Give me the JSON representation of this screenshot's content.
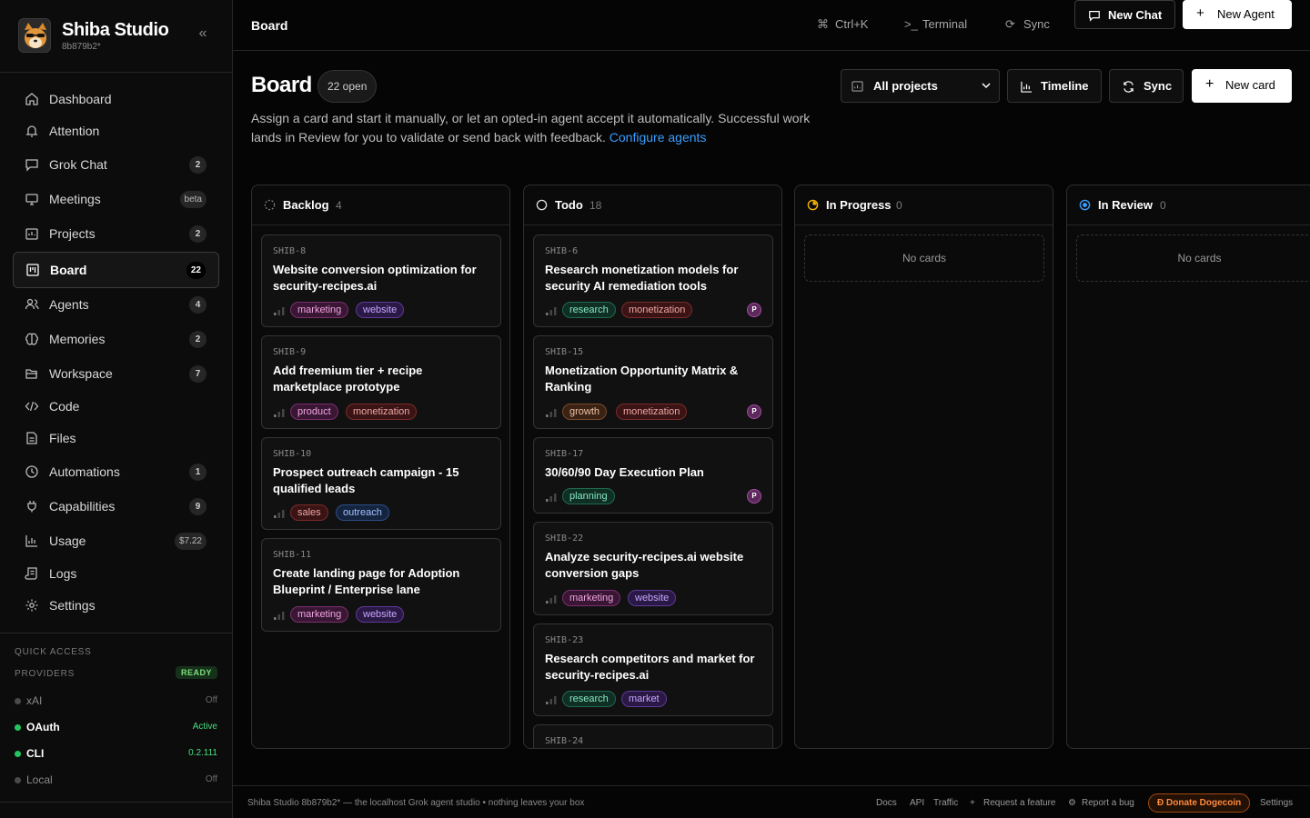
{
  "brand": {
    "name": "Shiba Studio",
    "sub": "8b879b2*"
  },
  "nav": [
    {
      "label": "Dashboard",
      "badge": ""
    },
    {
      "label": "Attention",
      "badge": ""
    },
    {
      "label": "Grok Chat",
      "badge": "2"
    },
    {
      "label": "Meetings",
      "badge": "beta"
    },
    {
      "label": "Projects",
      "badge": "2"
    },
    {
      "label": "Board",
      "badge": "22"
    },
    {
      "label": "Agents",
      "badge": "4"
    },
    {
      "label": "Memories",
      "badge": "2"
    },
    {
      "label": "Workspace",
      "badge": "7"
    },
    {
      "label": "Code",
      "badge": ""
    },
    {
      "label": "Files",
      "badge": ""
    },
    {
      "label": "Automations",
      "badge": "1"
    },
    {
      "label": "Capabilities",
      "badge": "9"
    },
    {
      "label": "Usage",
      "badge": "$7.22"
    },
    {
      "label": "Logs",
      "badge": ""
    },
    {
      "label": "Settings",
      "badge": ""
    }
  ],
  "quick_access": {
    "title": "QUICK ACCESS",
    "providers_title": "PROVIDERS",
    "ready": "READY",
    "providers": [
      {
        "name": "xAI",
        "status": "Off",
        "on": false
      },
      {
        "name": "OAuth",
        "status": "Active",
        "on": true
      },
      {
        "name": "CLI",
        "status": "0.2.111",
        "on": true
      },
      {
        "name": "Local",
        "status": "Off",
        "on": false
      }
    ]
  },
  "topbar": {
    "title": "Board",
    "shortcut": "Ctrl+K",
    "terminal": "Terminal",
    "sync": "Sync",
    "new_chat": "New Chat",
    "new_agent": "New Agent"
  },
  "page": {
    "title": "Board",
    "open_count": "22 open",
    "desc": "Assign a card and start it manually, or let an opted-in agent accept it automatically. Successful work lands in Review for you to validate or send back with feedback.",
    "desc_link": "Configure agents",
    "project_select": "All projects",
    "timeline": "Timeline",
    "sync": "Sync",
    "new_card": "New card"
  },
  "columns": [
    {
      "title": "Backlog",
      "count": "4",
      "cards": [
        {
          "id": "SHIB-8",
          "title": "Website conversion optimization for security-recipes.ai",
          "tags": [
            "marketing",
            "website"
          ],
          "avatar": ""
        },
        {
          "id": "SHIB-9",
          "title": "Add freemium tier + recipe marketplace prototype",
          "tags": [
            "product",
            "monetization"
          ],
          "avatar": ""
        },
        {
          "id": "SHIB-10",
          "title": "Prospect outreach campaign - 15 qualified leads",
          "tags": [
            "sales",
            "outreach"
          ],
          "avatar": ""
        },
        {
          "id": "SHIB-11",
          "title": "Create landing page for Adoption Blueprint / Enterprise lane",
          "tags": [
            "marketing",
            "website"
          ],
          "avatar": ""
        }
      ]
    },
    {
      "title": "Todo",
      "count": "18",
      "cards": [
        {
          "id": "SHIB-6",
          "title": "Research monetization models for security AI remediation tools",
          "tags": [
            "research",
            "monetization"
          ],
          "avatar": "P"
        },
        {
          "id": "SHIB-15",
          "title": "Monetization Opportunity Matrix & Ranking",
          "tags": [
            "growth",
            "monetization"
          ],
          "avatar": "P"
        },
        {
          "id": "SHIB-17",
          "title": "30/60/90 Day Execution Plan",
          "tags": [
            "planning"
          ],
          "avatar": "P"
        },
        {
          "id": "SHIB-22",
          "title": "Analyze security-recipes.ai website conversion gaps",
          "tags": [
            "marketing",
            "website"
          ],
          "avatar": ""
        },
        {
          "id": "SHIB-23",
          "title": "Research competitors and market for security-recipes.ai",
          "tags": [
            "research",
            "market"
          ],
          "avatar": ""
        },
        {
          "id": "SHIB-24",
          "title": "",
          "tags": [],
          "avatar": ""
        }
      ]
    },
    {
      "title": "In Progress",
      "count": "0",
      "empty": "No cards"
    },
    {
      "title": "In Review",
      "count": "0",
      "empty": "No cards"
    }
  ],
  "footer": {
    "text": "Shiba Studio 8b879b2* — the localhost Grok agent studio • nothing leaves your box",
    "docs": "Docs",
    "api": "API",
    "traffic": "Traffic",
    "request": "Request a feature",
    "bug": "Report a bug",
    "donate": "Ð Donate Dogecoin",
    "settings": "Settings"
  },
  "colors": {
    "accent_link": "#3b9eff",
    "in_progress": "#f5b400",
    "in_review": "#3b9eff",
    "active_green": "#22c55e",
    "donate_orange": "#ff8a3d"
  }
}
